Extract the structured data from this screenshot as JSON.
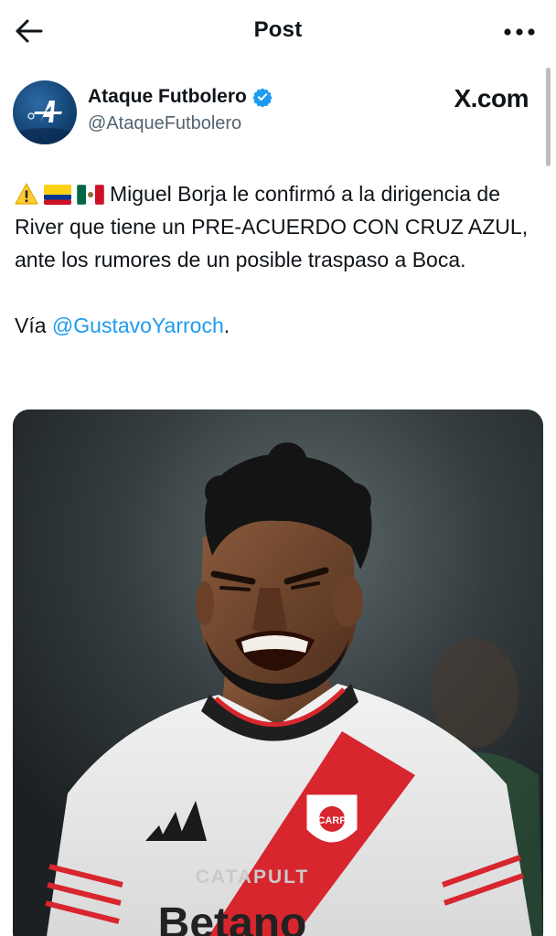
{
  "header": {
    "title": "Post"
  },
  "post": {
    "author": {
      "display_name": "Ataque Futbolero",
      "handle": "@AtaqueFutbolero",
      "verified": true
    },
    "source_brand": "X.com",
    "text": {
      "emojis": [
        "warning-emoji",
        "colombia-flag-emoji",
        "mexico-flag-emoji"
      ],
      "body": "Miguel Borja le confirmó a la dirigencia de River que tiene un PRE-ACUERDO CON CRUZ AZUL, ante los rumores de un posible traspaso a Boca.",
      "via_prefix": "Vía ",
      "via_mention": "@GustavoYarroch",
      "via_suffix": "."
    },
    "media": {
      "jersey_sponsor": "Betano",
      "jersey_text": "CATAPULT",
      "jersey_badge": "CARP"
    }
  },
  "colors": {
    "accent": "#1d9bf0",
    "text_primary": "#0f1419",
    "text_secondary": "#536471",
    "verified": "#1d9bf0",
    "jersey_band": "#d7262e"
  }
}
